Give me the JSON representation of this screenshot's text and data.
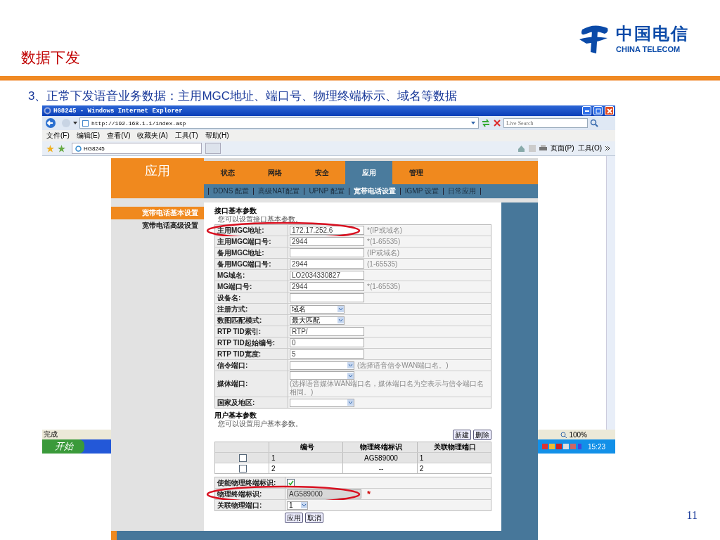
{
  "slide": {
    "title": "数据下发",
    "subtitle": "3、正常下发语音业务数据：主用MGC地址、端口号、物理终端标示、域名等数据",
    "page_number": "11"
  },
  "logo": {
    "name_cn": "中国电信",
    "name_en": "CHINA TELECOM"
  },
  "browser": {
    "title": "HG8245 - Windows Internet Explorer",
    "address": "http://192.168.1.1/index.asp",
    "search_placeholder": "Live Search",
    "menu": [
      "文件(F)",
      "编辑(E)",
      "查看(V)",
      "收藏夹(A)",
      "工具(T)",
      "帮助(H)"
    ],
    "tab": "HG8245",
    "commands": [
      "页面(P)",
      "工具(O)"
    ],
    "status": "完成",
    "zoom": "100%",
    "start": "开始",
    "clock": "15:23"
  },
  "router": {
    "section": "应用",
    "tabs": [
      {
        "label": "状态",
        "selected": false
      },
      {
        "label": "网络",
        "selected": false
      },
      {
        "label": "安全",
        "selected": false
      },
      {
        "label": "应用",
        "selected": true
      },
      {
        "label": "管理",
        "selected": false
      }
    ],
    "subnav": [
      {
        "label": "DDNS 配置",
        "selected": false
      },
      {
        "label": "高级NAT配置",
        "selected": false
      },
      {
        "label": "UPNP 配置",
        "selected": false
      },
      {
        "label": "宽带电话设置",
        "selected": true
      },
      {
        "label": "IGMP 设置",
        "selected": false
      },
      {
        "label": "日常应用",
        "selected": false
      }
    ],
    "sidebar": [
      {
        "label": "宽带电话基本设置",
        "selected": true
      },
      {
        "label": "宽带电话高级设置",
        "selected": false
      }
    ],
    "interface": {
      "title": "接口基本参数",
      "description": "您可以设置接口基本参数。",
      "fields": [
        {
          "kind": "text",
          "label": "主用MGC地址:",
          "value": "172.17.252.6",
          "hint": "*(IP或域名)",
          "highlighted": true
        },
        {
          "kind": "text",
          "label": "主用MGC端口号:",
          "value": "2944",
          "hint": "*(1-65535)",
          "highlighted": false
        },
        {
          "kind": "text",
          "label": "备用MGC地址:",
          "hint": "(IP或域名)",
          "highlighted": false
        },
        {
          "kind": "text",
          "label": "备用MGC端口号:",
          "value": "2944",
          "hint": "(1-65535)",
          "highlighted": false
        },
        {
          "kind": "text",
          "label": "MG域名:",
          "value": "LO2034330827",
          "highlighted": false
        },
        {
          "kind": "text",
          "label": "MG端口号:",
          "value": "2944",
          "hint": "*(1-65535)",
          "highlighted": false
        },
        {
          "kind": "text",
          "label": "设备名:",
          "highlighted": false
        },
        {
          "kind": "select",
          "label": "注册方式:",
          "value": "域名",
          "highlighted": false
        },
        {
          "kind": "select",
          "label": "数图匹配模式:",
          "value": "最大匹配",
          "highlighted": false
        },
        {
          "kind": "text",
          "label": "RTP TID索引:",
          "value": "RTP/",
          "highlighted": false
        },
        {
          "kind": "text",
          "label": "RTP TID起始编号:",
          "value": "0",
          "highlighted": false
        },
        {
          "kind": "text",
          "label": "RTP TID宽度:",
          "value": "5",
          "highlighted": false
        },
        {
          "kind": "wideselect",
          "label": "信令端口:",
          "hint": "(选择语音信令WAN端口名。)",
          "highlighted": false
        },
        {
          "kind": "wideselect",
          "label": "媒体端口:",
          "hint": "(选择语音媒体WAN端口名，媒体端口名为空表示与信令端口名相同。)",
          "highlighted": false
        },
        {
          "kind": "wideselect",
          "label": "国家及地区:",
          "highlighted": false
        }
      ]
    },
    "user": {
      "title": "用户基本参数",
      "description": "您可以设置用户基本参数。",
      "buttons": [
        "新建",
        "删除"
      ],
      "columns": [
        "编号",
        "物理终端标识",
        "关联物理端口"
      ],
      "rows": [
        {
          "checked": false,
          "cells": [
            "1",
            "AG589000",
            "1"
          ]
        },
        {
          "checked": false,
          "cells": [
            "2",
            "--",
            "2"
          ]
        }
      ],
      "fields": [
        {
          "kind": "checkbox",
          "label": "使能物理终端标识:",
          "checked": true,
          "highlighted": false
        },
        {
          "kind": "text",
          "label": "物理终端标识:",
          "value": "AG589000",
          "hint": "*",
          "disabled": true,
          "highlighted": true
        },
        {
          "kind": "select",
          "label": "关联物理端口:",
          "value": "1",
          "highlighted": false
        }
      ],
      "actions": [
        "应用",
        "取消"
      ]
    }
  }
}
